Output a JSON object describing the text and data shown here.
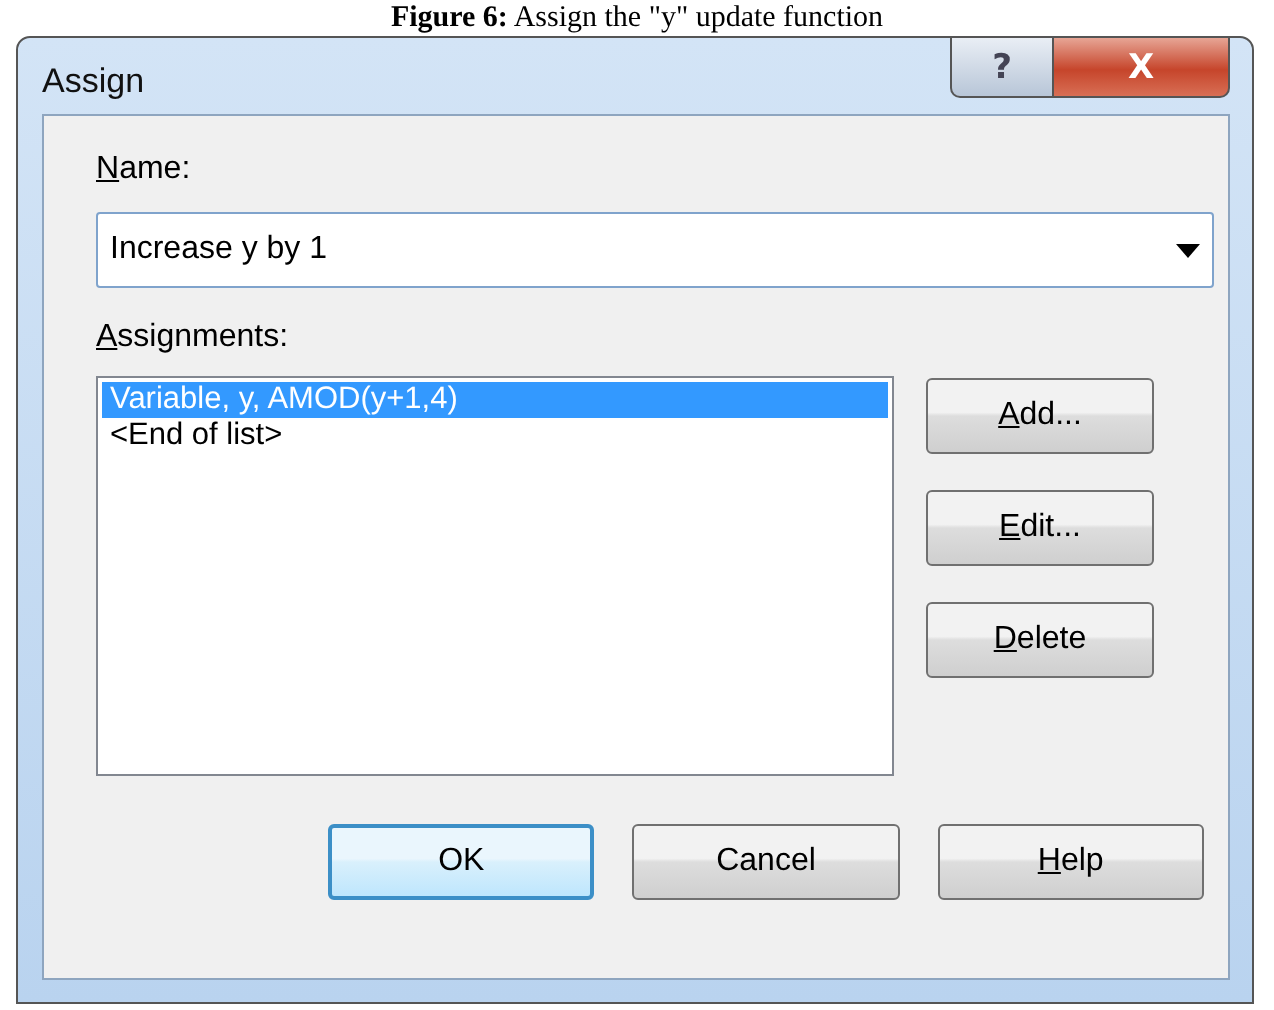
{
  "caption": "**Figure 6:** Assign the \"y\" update function",
  "window": {
    "title": "Assign"
  },
  "title_buttons": [
    {
      "kind": "help",
      "label": "?"
    },
    {
      "kind": "close",
      "label": "X"
    }
  ],
  "name_field": {
    "mnemonic": "N",
    "label_rest": "ame:",
    "value": "Increase y by 1"
  },
  "assignments": {
    "mnemonic": "A",
    "label_rest": "ssignments:",
    "items": [
      {
        "text": "Variable, y, AMOD(y+1,4)",
        "selected": true
      },
      {
        "text": "<End of list>",
        "selected": false
      }
    ]
  },
  "side_buttons": [
    {
      "mnemonic": "A",
      "label_rest": "dd..."
    },
    {
      "mnemonic": "E",
      "label_rest": "dit..."
    },
    {
      "mnemonic": "D",
      "label_rest": "elete"
    }
  ],
  "bottom_buttons": [
    {
      "label": "OK",
      "default": true
    },
    {
      "label": "Cancel",
      "default": false
    },
    {
      "mnemonic": "H",
      "label_rest": "elp",
      "default": false
    }
  ]
}
